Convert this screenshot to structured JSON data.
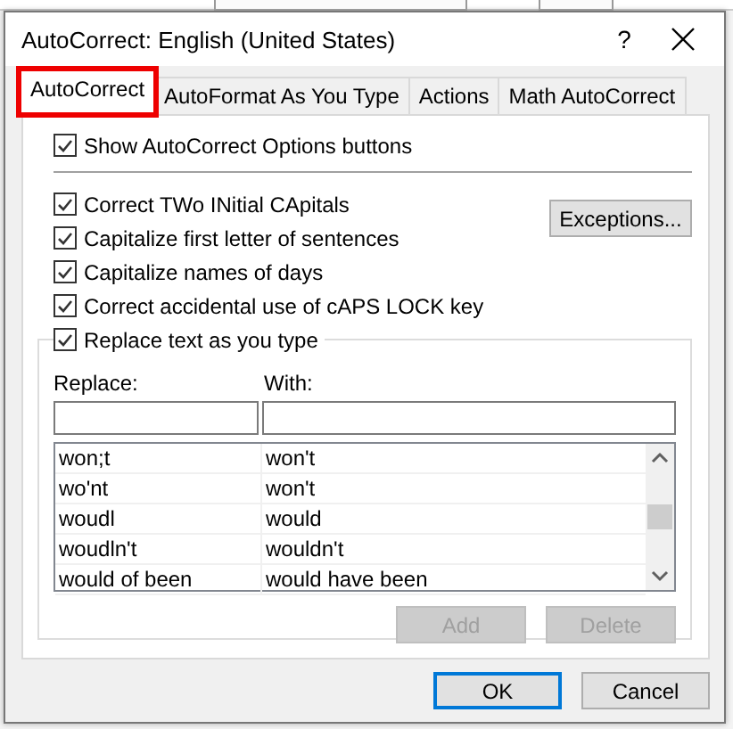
{
  "window": {
    "title": "AutoCorrect: English (United States)",
    "help": "?"
  },
  "tabs": [
    {
      "label": "AutoCorrect",
      "selected": true,
      "highlighted": true
    },
    {
      "label": "AutoFormat As You Type",
      "selected": false,
      "highlighted": false
    },
    {
      "label": "Actions",
      "selected": false,
      "highlighted": false
    },
    {
      "label": "Math AutoCorrect",
      "selected": false,
      "highlighted": false
    }
  ],
  "show_options_buttons": {
    "label": "Show AutoCorrect Options buttons",
    "checked": true
  },
  "options": [
    {
      "label": "Correct TWo INitial CApitals",
      "checked": true
    },
    {
      "label": "Capitalize first letter of sentences",
      "checked": true
    },
    {
      "label": "Capitalize names of days",
      "checked": true
    },
    {
      "label": "Correct accidental use of cAPS LOCK key",
      "checked": true
    }
  ],
  "exceptions_button": "Exceptions...",
  "replace_as_you_type": {
    "label": "Replace text as you type",
    "checked": true
  },
  "replace_label": "Replace:",
  "with_label": "With:",
  "entries": [
    {
      "replace": "won;t",
      "with": "won't"
    },
    {
      "replace": "wo'nt",
      "with": "won't"
    },
    {
      "replace": "woudl",
      "with": "would"
    },
    {
      "replace": "woudln't",
      "with": "wouldn't"
    },
    {
      "replace": "would of been",
      "with": "would have been"
    }
  ],
  "list_buttons": [
    {
      "label": "Add",
      "disabled": true
    },
    {
      "label": "Delete",
      "disabled": true
    }
  ],
  "footer_buttons": [
    {
      "label": "OK",
      "default": true
    },
    {
      "label": "Cancel",
      "default": false
    }
  ]
}
